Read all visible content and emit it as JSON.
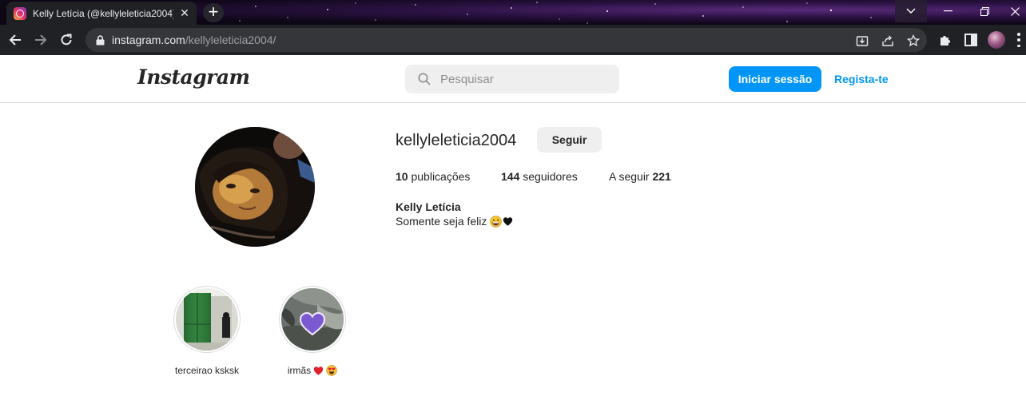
{
  "browser": {
    "tab": {
      "title": "Kelly Letícia (@kellyleleticia2004)",
      "favicon": "instagram-icon"
    },
    "url": {
      "host": "instagram.com",
      "path": "/kellyleleticia2004/"
    },
    "icons": [
      "back-arrow-icon",
      "forward-arrow-icon",
      "reload-icon",
      "lock-icon",
      "install-icon",
      "share-icon",
      "bookmark-star-icon",
      "extensions-icon",
      "sidebar-icon",
      "profile-avatar",
      "more-menu-icon"
    ]
  },
  "header": {
    "logo": "Instagram",
    "search_placeholder": "Pesquisar",
    "login_label": "Iniciar sessão",
    "signup_label": "Regista-te",
    "colors": {
      "primary": "#0095f6",
      "search_bg": "#efefef"
    }
  },
  "profile": {
    "username": "kellyleleticia2004",
    "follow_label": "Seguir",
    "stats": {
      "posts_count": "10",
      "posts_label": "publicações",
      "followers_count": "144",
      "followers_label": "seguidores",
      "following_label": "A seguir",
      "following_count": "221"
    },
    "full_name": "Kelly Letícia",
    "bio_text": "Somente seja feliz",
    "bio_emojis": [
      "grinning-face-icon",
      "black-heart-icon"
    ]
  },
  "highlights": [
    {
      "label": "terceirao ksksk",
      "emojis": []
    },
    {
      "label": "irmãs",
      "emojis": [
        "red-heart-icon",
        "heart-eyes-icon"
      ]
    }
  ]
}
